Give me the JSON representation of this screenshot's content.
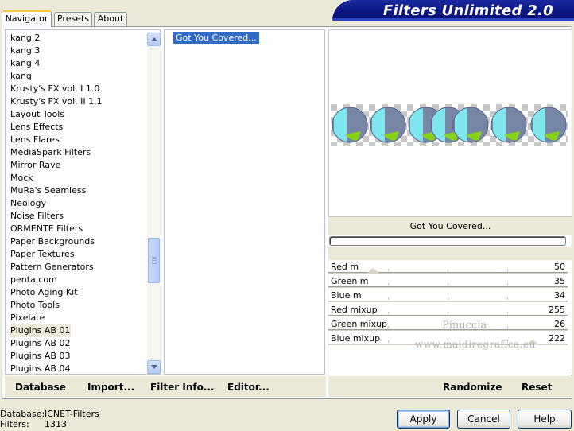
{
  "tabs": [
    {
      "label": "Navigator",
      "active": true
    },
    {
      "label": "Presets",
      "active": false
    },
    {
      "label": "About",
      "active": false
    }
  ],
  "banner": {
    "title": "Filters Unlimited 2.0"
  },
  "categories": [
    {
      "label": "kang 2"
    },
    {
      "label": "kang 3"
    },
    {
      "label": "kang 4"
    },
    {
      "label": "kang"
    },
    {
      "label": "Krusty's FX vol. I 1.0"
    },
    {
      "label": "Krusty's FX vol. II 1.1"
    },
    {
      "label": "Layout Tools"
    },
    {
      "label": "Lens Effects"
    },
    {
      "label": "Lens Flares"
    },
    {
      "label": "MediaSpark Filters"
    },
    {
      "label": "Mirror Rave"
    },
    {
      "label": "Mock"
    },
    {
      "label": "MuRa's Seamless"
    },
    {
      "label": "Neology"
    },
    {
      "label": "Noise Filters"
    },
    {
      "label": "ORMENTE Filters"
    },
    {
      "label": "Paper Backgrounds"
    },
    {
      "label": "Paper Textures"
    },
    {
      "label": "Pattern Generators"
    },
    {
      "label": "penta.com"
    },
    {
      "label": "Photo Aging Kit"
    },
    {
      "label": "Photo Tools"
    },
    {
      "label": "Pixelate"
    },
    {
      "label": "Plugins AB 01",
      "selected": true
    },
    {
      "label": "Plugins AB 02"
    },
    {
      "label": "Plugins AB 03"
    },
    {
      "label": "Plugins AB 04"
    }
  ],
  "filters": [
    {
      "label": "Got You Covered...",
      "selected": true
    }
  ],
  "preview": {
    "caption": "Got You Covered..."
  },
  "params": [
    {
      "label": "Red m",
      "value": "50"
    },
    {
      "label": "Green m",
      "value": "35"
    },
    {
      "label": "Blue m",
      "value": "34"
    },
    {
      "label": "Red mixup",
      "value": "255"
    },
    {
      "label": "Green mixup",
      "value": "26"
    },
    {
      "label": "Blue mixup",
      "value": "222"
    }
  ],
  "watermark": {
    "line1": "Pinuccia",
    "line2": "www.maidiregrafica.eu"
  },
  "left_actions": {
    "database": "Database",
    "import": "Import...",
    "filter_info": "Filter Info...",
    "editor": "Editor..."
  },
  "right_actions": {
    "randomize": "Randomize",
    "reset": "Reset"
  },
  "status": {
    "database_label": "Database:",
    "database_value": "ICNET-Filters",
    "filters_label": "Filters:",
    "filters_value": "1313"
  },
  "buttons": {
    "apply": "Apply",
    "cancel": "Cancel",
    "help": "Help"
  },
  "icons": {
    "scroll_up": "chevron-up-icon",
    "scroll_down": "chevron-down-icon"
  },
  "colors": {
    "accent": "#316AC5",
    "banner": "#0C1680",
    "tab_highlight": "#FFC83C"
  }
}
